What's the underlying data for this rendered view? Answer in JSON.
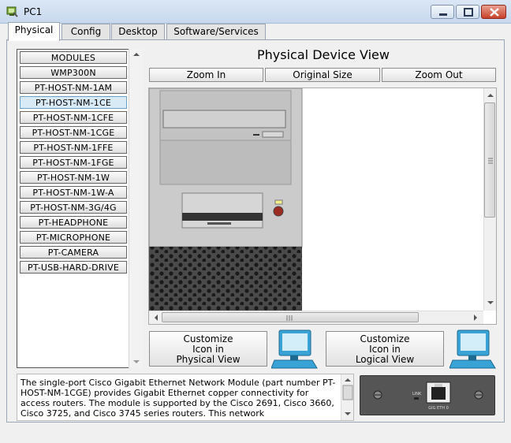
{
  "window": {
    "title": "PC1",
    "controls": {
      "minimize": "minimize-icon",
      "maximize": "maximize-icon",
      "close": "close-icon"
    }
  },
  "tabs": [
    {
      "label": "Physical",
      "active": true
    },
    {
      "label": "Config",
      "active": false
    },
    {
      "label": "Desktop",
      "active": false
    },
    {
      "label": "Software/Services",
      "active": false
    }
  ],
  "modules": [
    "MODULES",
    "WMP300N",
    "PT-HOST-NM-1AM",
    "PT-HOST-NM-1CE",
    "PT-HOST-NM-1CFE",
    "PT-HOST-NM-1CGE",
    "PT-HOST-NM-1FFE",
    "PT-HOST-NM-1FGE",
    "PT-HOST-NM-1W",
    "PT-HOST-NM-1W-A",
    "PT-HOST-NM-3G/4G",
    "PT-HEADPHONE",
    "PT-MICROPHONE",
    "PT-CAMERA",
    "PT-USB-HARD-DRIVE"
  ],
  "selected_module_index": 3,
  "physical_view": {
    "title": "Physical Device View",
    "zoom_in": "Zoom In",
    "original_size": "Original Size",
    "zoom_out": "Zoom Out"
  },
  "customize": {
    "physical": [
      "Customize",
      "Icon in",
      "Physical View"
    ],
    "logical": [
      "Customize",
      "Icon in",
      "Logical View"
    ]
  },
  "description": "The single-port Cisco Gigabit Ethernet Network Module (part number PT-HOST-NM-1CGE) provides Gigabit Ethernet copper connectivity for access routers. The module is supported by the Cisco 2691, Cisco 3660, Cisco 3725, and Cisco 3745 series routers. This network",
  "module_image": {
    "link_label": "LINK",
    "port_label": "GIG ETH 0"
  },
  "colors": {
    "accent_blue": "#3aa3d6",
    "tower_gray": "#c9c9c9",
    "close_red": "#c8412b"
  }
}
